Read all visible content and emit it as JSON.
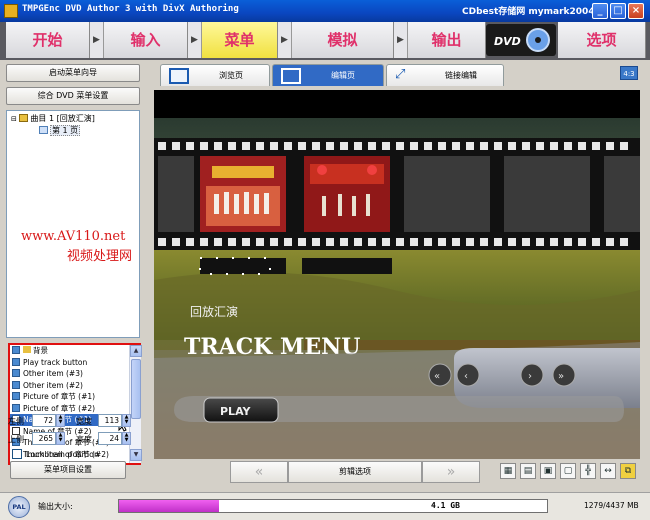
{
  "window": {
    "title": "TMPGEnc DVD Author 3 with DivX Authoring",
    "right_text": "CDbest存储网 mymark2004",
    "controls": {
      "minimize": "_",
      "maximize": "□",
      "close": "×"
    }
  },
  "nav": {
    "steps": [
      {
        "label": "开始"
      },
      {
        "label": "输入"
      },
      {
        "label": "菜单"
      },
      {
        "label": "模拟"
      },
      {
        "label": "输出"
      },
      {
        "label": "选项"
      }
    ],
    "active": "菜单",
    "logo_text": "DVD"
  },
  "left": {
    "wizard_button": "启动菜单向导",
    "dvd_settings_button": "综合 DVD 菜单设置",
    "tree": {
      "root": "曲目 1 [回放汇演]",
      "child": "第 1 页"
    },
    "watermark": {
      "line1": "www.AV110.net",
      "line2": "视频处理网"
    },
    "items": [
      "背景",
      "Play track button",
      "Other item (#3)",
      "Other item (#2)",
      "Picture of 章节 (#1)",
      "Picture of 章节 (#2)",
      "Name of 章节 (#1)",
      "Name of 章节 (#2)",
      "Thumbnail of 章节 (#1)",
      "Thumbnail of 章节 (#2)"
    ],
    "selected_item_index": 6,
    "fields": {
      "left_label": "左侧",
      "left_value": "72",
      "width_label": "宽度",
      "width_value": "113",
      "top_label": "上侧",
      "top_value": "265",
      "height_label": "高度",
      "height_value": "24"
    },
    "lock_label": "Lock item position",
    "item_settings_button": "菜单项目设置"
  },
  "tabs": [
    {
      "label": "浏览页"
    },
    {
      "label": "编辑页"
    },
    {
      "label": "链接编辑"
    }
  ],
  "active_tab": "编辑页",
  "aspect_badge": "4:3",
  "canvas": {
    "subtitle": "回放汇演",
    "title_big": "TRACK MENU",
    "play_label": "PLAY"
  },
  "bottom": {
    "prev": "«",
    "options": "剪辑选项",
    "next": "»"
  },
  "status": {
    "tv_system": "PAL",
    "output_size_label": "输出大小:",
    "size_text": "4.1 GB",
    "size_fraction": 0.233,
    "capacity": "1279/4437 MB"
  },
  "colors": {
    "accent": "#316ac5",
    "nav_text": "#e0306a",
    "nav_active": "#f0e040",
    "size_bar": "#d040d8",
    "highlight_border": "#e01010"
  }
}
